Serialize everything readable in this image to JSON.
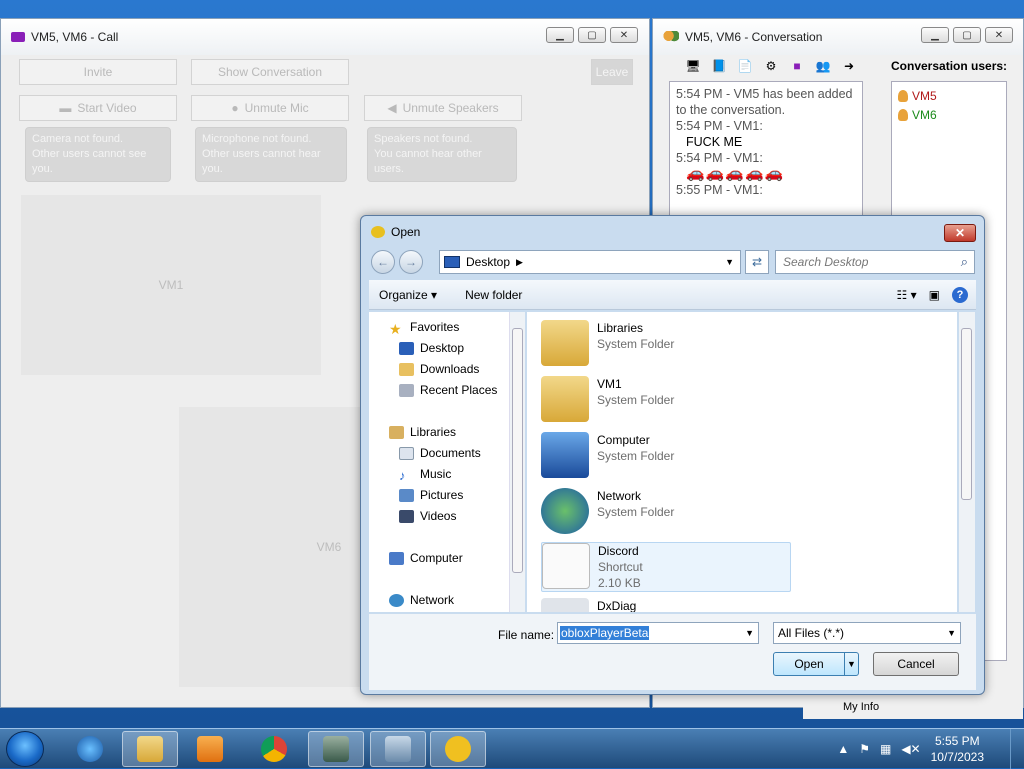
{
  "call_window": {
    "title": "VM5, VM6 - Call",
    "buttons": {
      "invite": "Invite",
      "show_conversation": "Show Conversation",
      "leave": "Leave",
      "start_video": "Start Video",
      "unmute_mic": "Unmute Mic",
      "unmute_speakers": "Unmute Speakers"
    },
    "tips": {
      "camera": [
        "Camera not found.",
        "Other users cannot see you."
      ],
      "microphone": [
        "Microphone not found.",
        "Other users cannot hear you."
      ],
      "speakers": [
        "Speakers not found.",
        "You cannot hear other users."
      ]
    },
    "tiles": {
      "vm1": "VM1",
      "vm6": "VM6"
    }
  },
  "conversation_window": {
    "title": "VM5, VM6 - Conversation",
    "users_label": "Conversation users:",
    "users": [
      {
        "name": "VM5",
        "color": "#b01818"
      },
      {
        "name": "VM6",
        "color": "#1a8a1a"
      }
    ],
    "messages": [
      {
        "meta": "5:54 PM - VM5 has been added to the conversation.",
        "body": ""
      },
      {
        "meta": "5:54 PM - VM1:",
        "body": "FUCK ME"
      },
      {
        "meta": "5:54 PM - VM1:",
        "body": "🚗🚗🚗🚗🚗"
      },
      {
        "meta": "5:55 PM - VM1:",
        "body": ""
      }
    ],
    "footer": "My Info"
  },
  "open_dialog": {
    "title": "Open",
    "location": "Desktop",
    "search_placeholder": "Search Desktop",
    "organize": "Organize",
    "new_folder": "New folder",
    "nav": {
      "favorites": "Favorites",
      "desktop": "Desktop",
      "downloads": "Downloads",
      "recent_places": "Recent Places",
      "libraries": "Libraries",
      "documents": "Documents",
      "music": "Music",
      "pictures": "Pictures",
      "videos": "Videos",
      "computer": "Computer",
      "network": "Network"
    },
    "files": [
      {
        "name": "Libraries",
        "type": "System Folder",
        "size": ""
      },
      {
        "name": "VM1",
        "type": "System Folder",
        "size": ""
      },
      {
        "name": "Computer",
        "type": "System Folder",
        "size": ""
      },
      {
        "name": "Network",
        "type": "System Folder",
        "size": ""
      },
      {
        "name": "Discord",
        "type": "Shortcut",
        "size": "2.10 KB"
      },
      {
        "name": "DxDiag",
        "type": "",
        "size": ""
      }
    ],
    "file_name_label": "File name:",
    "file_name_value": "obloxPlayerBeta",
    "file_type": "All Files (*.*)",
    "open_label": "Open",
    "cancel_label": "Cancel"
  },
  "taskbar": {
    "time": "5:55 PM",
    "date": "10/7/2023"
  },
  "colors": {
    "accent": "#3380d8",
    "desktop": "#1f64b0"
  }
}
